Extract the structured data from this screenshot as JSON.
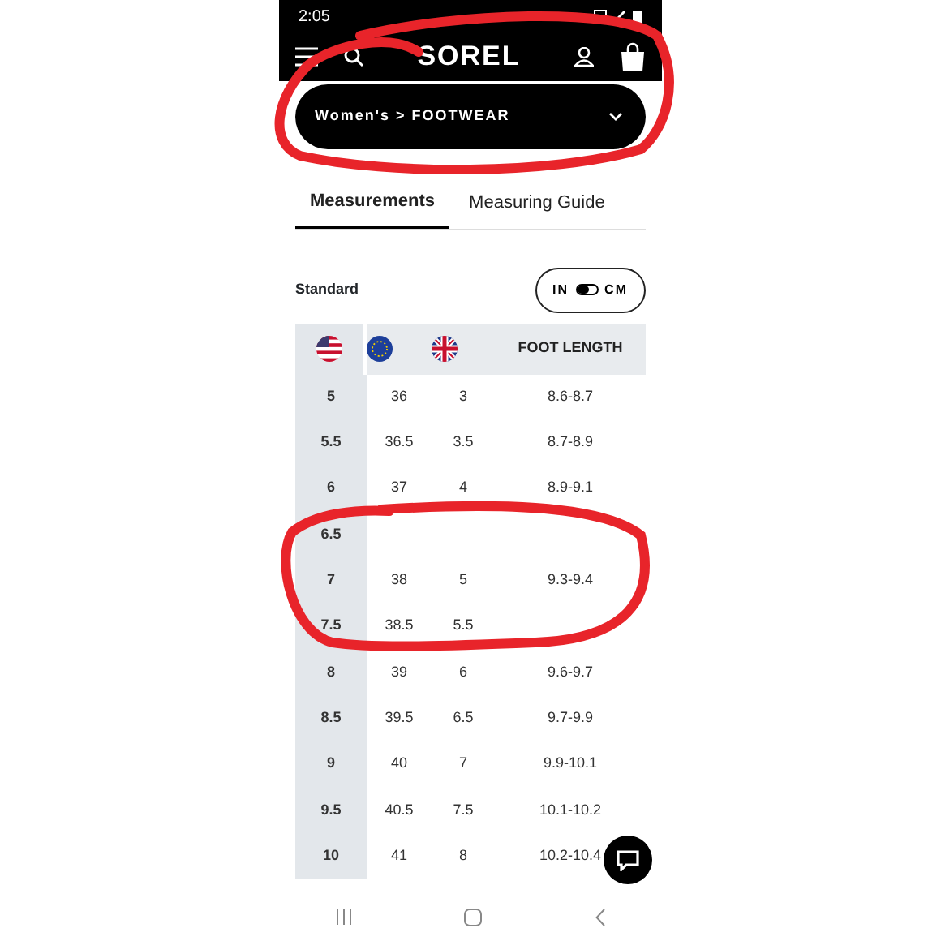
{
  "status_bar": {
    "time": "2:05"
  },
  "header": {
    "logo": "SOREL"
  },
  "breadcrumb": {
    "text": "Women's > FOOTWEAR"
  },
  "tabs": [
    {
      "label": "Measurements",
      "selected": true
    },
    {
      "label": "Measuring Guide",
      "selected": false
    }
  ],
  "sizing": {
    "label": "Standard",
    "unit_toggle": {
      "left": "IN",
      "right": "CM",
      "on": false
    }
  },
  "table": {
    "columns": [
      {
        "kind": "flag-us"
      },
      {
        "kind": "flag-eu"
      },
      {
        "kind": "flag-uk"
      },
      {
        "kind": "text",
        "label": "FOOT LENGTH"
      }
    ],
    "rows": [
      [
        "5",
        "36",
        "3",
        "8.6-8.7"
      ],
      [
        "5.5",
        "36.5",
        "3.5",
        "8.7-8.9"
      ],
      [
        "6",
        "37",
        "4",
        "8.9-9.1"
      ],
      [
        "6.5"
      ],
      [
        "7",
        "38",
        "5",
        "9.3-9.4"
      ],
      [
        "7.5",
        "38.5",
        "5.5"
      ],
      [
        "8",
        "39",
        "6",
        "9.6-9.7"
      ],
      [
        "8.5",
        "39.5",
        "6.5",
        "9.7-9.9"
      ],
      [
        "9",
        "40",
        "7",
        "9.9-10.1"
      ],
      [
        "9.5",
        "40.5",
        "7.5",
        "10.1-10.2"
      ],
      [
        "10",
        "41",
        "8",
        "10.2-10.4"
      ]
    ]
  }
}
